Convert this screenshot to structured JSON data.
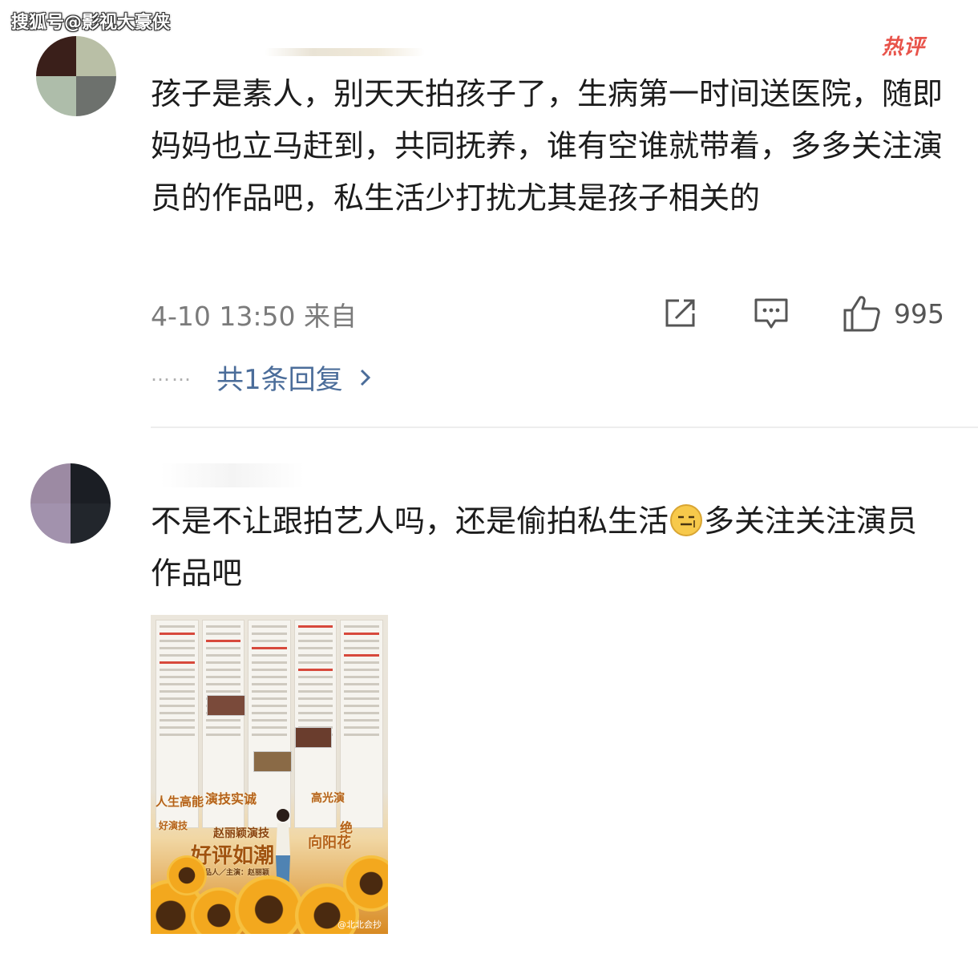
{
  "watermark": "搜狐号@影视大豪侠",
  "comment1": {
    "hot_badge": "热评",
    "text": "孩子是素人，别天天拍孩子了，生病第一时间送医院，随即妈妈也立马赶到，共同抚养，谁有空谁就带着，多多关注演员的作品吧，私生活少打扰尤其是孩子相关的",
    "meta": "4-10 13:50 来自",
    "like_count": "995",
    "replies_dots": "……",
    "replies_label": "共1条回复",
    "icons": {
      "share": "share-icon",
      "reply": "comment-icon",
      "like": "thumbs-up-icon",
      "chevron": "chevron-right-icon"
    }
  },
  "comment2": {
    "text_before_emoji": "不是不让跟拍艺人吗，还是偷拍私生活",
    "text_after_emoji": "多关注关注演员作品吧",
    "emoji": "emoji-face-icon",
    "poster": {
      "headline": "赵丽颖演技",
      "slogan": "好评如潮",
      "words": [
        "人生高能",
        "演技实诚",
        "高光演",
        "好演技",
        "绝",
        "向阳花"
      ],
      "credit": "出品人／主演：赵丽颖",
      "signature": "@北北会抄"
    }
  },
  "colors": {
    "hot_red": "#e8534a",
    "link_blue": "#4b6d9a",
    "meta_gray": "#7b7b7b"
  }
}
